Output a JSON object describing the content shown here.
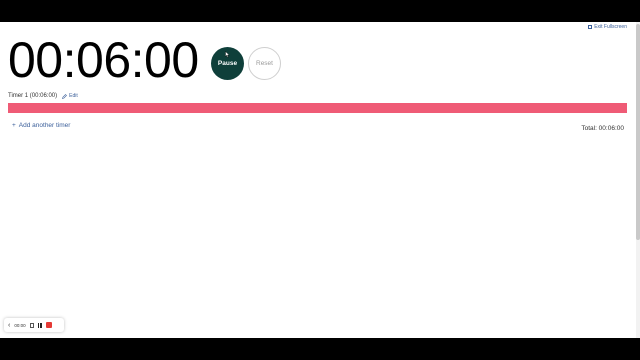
{
  "header": {
    "exit_fullscreen_label": "Exit Fullscreen"
  },
  "timer": {
    "display": "00:06:00",
    "pause_label": "Pause",
    "reset_label": "Reset",
    "name_label": "Timer 1 (00:06:00)",
    "edit_label": "Edit",
    "progress_fraction": 1.0,
    "progress_color": "#ef5b76",
    "add_another_label": "Add another timer",
    "total_label": "Total: 00:06:00"
  },
  "recorder": {
    "time": "00:00",
    "stop_color": "#e53935"
  },
  "icons": {
    "add": "plus-icon",
    "edit": "pencil-icon",
    "exit_fullscreen": "exit-fullscreen-icon"
  }
}
